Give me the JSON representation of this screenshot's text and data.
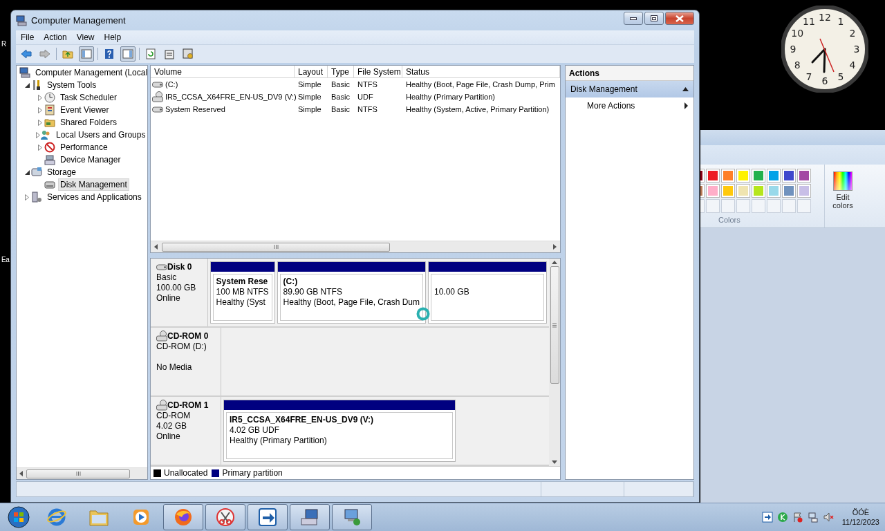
{
  "desktop": {
    "edge_labels": [
      "R",
      "Ea"
    ]
  },
  "clock": {
    "numerals": [
      "12",
      "11",
      "1",
      "10",
      "2",
      "9",
      "3",
      "8",
      "4",
      "7",
      "5",
      "6"
    ]
  },
  "window": {
    "title": "Computer Management",
    "menu": [
      "File",
      "Action",
      "View",
      "Help"
    ]
  },
  "tree": [
    {
      "label": "Computer Management (Local",
      "kind": "computer",
      "selected": false,
      "children": [
        {
          "label": "System Tools",
          "kind": "tools",
          "selected": false,
          "expanded": true,
          "children": [
            {
              "label": "Task Scheduler",
              "kind": "clock",
              "selected": false,
              "expanded": false
            },
            {
              "label": "Event Viewer",
              "kind": "log",
              "selected": false,
              "expanded": false
            },
            {
              "label": "Shared Folders",
              "kind": "share",
              "selected": false,
              "expanded": false
            },
            {
              "label": "Local Users and Groups",
              "kind": "users",
              "selected": false,
              "expanded": false
            },
            {
              "label": "Performance",
              "kind": "performance",
              "selected": false,
              "expanded": false
            },
            {
              "label": "Device Manager",
              "kind": "device",
              "selected": false
            }
          ]
        },
        {
          "label": "Storage",
          "kind": "storage",
          "selected": false,
          "expanded": true,
          "children": [
            {
              "label": "Disk Management",
              "kind": "disk",
              "selected": true
            }
          ]
        },
        {
          "label": "Services and Applications",
          "kind": "services",
          "selected": false,
          "expanded": false
        }
      ]
    }
  ],
  "volumes": {
    "columns": [
      "Volume",
      "Layout",
      "Type",
      "File System",
      "Status"
    ],
    "rows": [
      {
        "kind": "hdd",
        "cells": [
          "(C:)",
          "Simple",
          "Basic",
          "NTFS",
          "Healthy (Boot, Page File, Crash Dump, Prim"
        ]
      },
      {
        "kind": "cd",
        "cells": [
          "IR5_CCSA_X64FRE_EN-US_DV9 (V:)",
          "Simple",
          "Basic",
          "UDF",
          "Healthy (Primary Partition)"
        ]
      },
      {
        "kind": "hdd",
        "cells": [
          "System Reserved",
          "Simple",
          "Basic",
          "NTFS",
          "Healthy (System, Active, Primary Partition)"
        ]
      }
    ]
  },
  "disks": [
    {
      "kind": "hdd",
      "name": "Disk 0",
      "type": "Basic",
      "size": "100.00 GB",
      "status": "Online",
      "partitions": [
        {
          "name": "System Rese",
          "detail": "100 MB NTFS",
          "status": "Healthy (Syst",
          "color": "#000080"
        },
        {
          "name": "(C:)",
          "detail": "89.90 GB NTFS",
          "status": "Healthy (Boot, Page File, Crash Dum",
          "color": "#000080"
        },
        {
          "detail": "10.00 GB",
          "color": "#000080"
        }
      ]
    },
    {
      "kind": "cd",
      "name": "CD-ROM 0",
      "type": "CD-ROM (D:)",
      "status": "No Media"
    },
    {
      "kind": "cd",
      "name": "CD-ROM 1",
      "type": "CD-ROM",
      "size": "4.02 GB",
      "status": "Online",
      "partitions": [
        {
          "name": "IR5_CCSA_X64FRE_EN-US_DV9  (V:)",
          "detail": "4.02 GB UDF",
          "status": "Healthy (Primary Partition)",
          "color": "#000080"
        }
      ]
    }
  ],
  "legend": [
    {
      "label": "Unallocated",
      "color": "#000000"
    },
    {
      "label": "Primary partition",
      "color": "#000080"
    }
  ],
  "actions": {
    "title": "Actions",
    "sections": [
      {
        "label": "Disk Management",
        "expanded": true,
        "items": [
          {
            "label": "More Actions",
            "submenu": true
          }
        ]
      }
    ]
  },
  "paint": {
    "swatches": [
      {
        "color": "#880015"
      },
      {
        "color": "#ed1c24"
      },
      {
        "color": "#ff7f27"
      },
      {
        "color": "#fff200"
      },
      {
        "color": "#22b14c"
      },
      {
        "color": "#00a2e8"
      },
      {
        "color": "#3f48cc"
      },
      {
        "color": "#a349a4"
      },
      {
        "color": "#b97a57"
      },
      {
        "color": "#ffaec9"
      },
      {
        "color": "#ffc90e"
      },
      {
        "color": "#efe4b0"
      },
      {
        "color": "#b5e61d"
      },
      {
        "color": "#99d9ea"
      },
      {
        "color": "#7092be"
      },
      {
        "color": "#c8bfe7"
      }
    ],
    "group_label": "Colors",
    "edit_button": "Edit colors"
  },
  "taskbar": {
    "apps": [
      {
        "kind": "browser",
        "running": false
      },
      {
        "kind": "folder",
        "running": false
      },
      {
        "kind": "media",
        "running": false
      },
      {
        "kind": "firefox",
        "running": true
      },
      {
        "kind": "scissors",
        "running": true
      },
      {
        "kind": "arrow",
        "running": true
      },
      {
        "kind": "computer",
        "running": true
      },
      {
        "kind": "network",
        "running": true
      }
    ],
    "tray": [
      {
        "kind": "arrow"
      },
      {
        "kind": "shield"
      },
      {
        "kind": "flag"
      },
      {
        "kind": "network"
      },
      {
        "kind": "speaker"
      }
    ],
    "time": "ÕÓÈ",
    "date": "11/12/2023"
  }
}
